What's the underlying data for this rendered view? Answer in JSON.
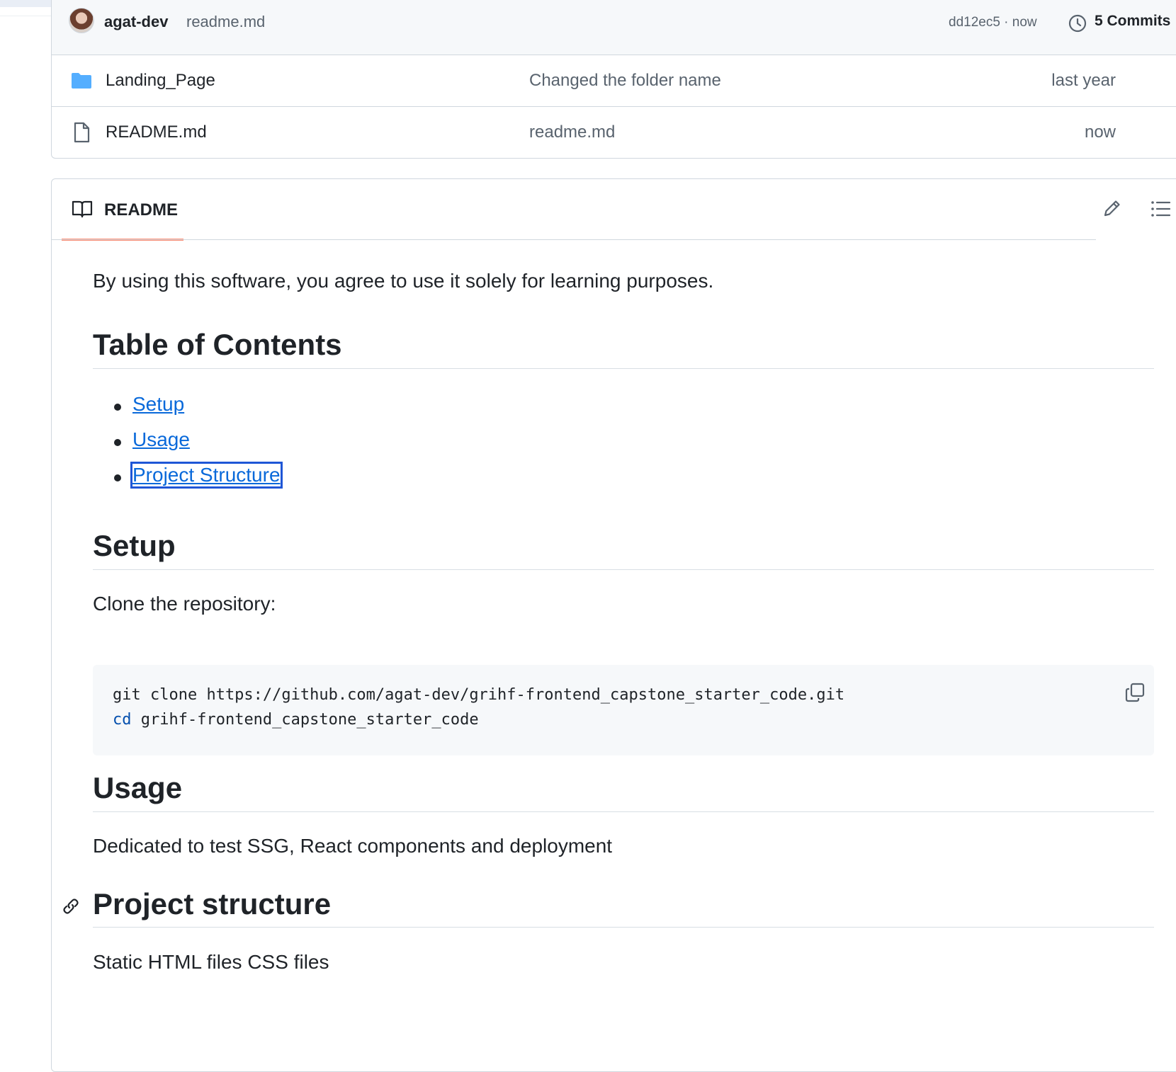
{
  "commit_bar": {
    "author": "agat-dev",
    "message": "readme.md",
    "hash_time": "dd12ec5 · now",
    "commits_count": "5 Commits"
  },
  "files": [
    {
      "icon": "folder-icon",
      "name": "Landing_Page",
      "message": "Changed the folder name",
      "date": "last year"
    },
    {
      "icon": "file-icon",
      "name": "README.md",
      "message": "readme.md",
      "date": "now"
    }
  ],
  "readme": {
    "tab_label": "README",
    "intro": "By using this software, you agree to use it solely for learning purposes.",
    "toc_heading": "Table of Contents",
    "toc_items": [
      "Setup",
      "Usage",
      "Project Structure"
    ],
    "setup_heading": "Setup",
    "setup_text": "Clone the repository:",
    "code": {
      "line1": "git clone https://github.com/agat-dev/grihf-frontend_capstone_starter_code.git",
      "line2_cmd": "cd",
      "line2_arg": " grihf-frontend_capstone_starter_code"
    },
    "usage_heading": "Usage",
    "usage_text": "Dedicated to test SSG, React components and deployment",
    "structure_heading": "Project structure",
    "structure_text": "Static HTML files CSS files"
  },
  "colors": {
    "link": "#0969da",
    "tab_underline": "#fd8c73",
    "folder": "#54aeff",
    "focus_outline": "#1f56d6"
  }
}
